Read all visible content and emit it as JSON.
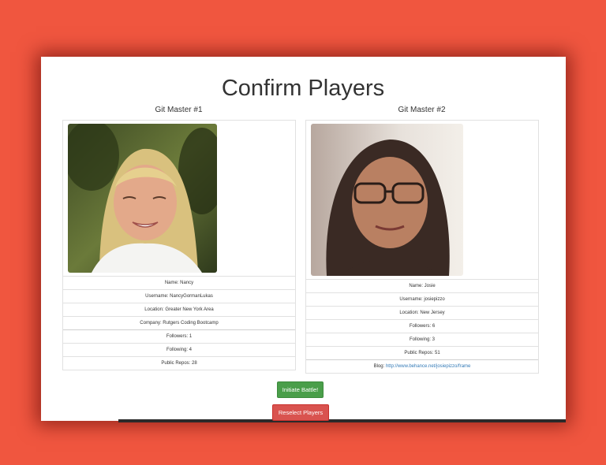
{
  "page": {
    "title": "Confirm Players"
  },
  "players": [
    {
      "heading": "Git Master #1",
      "name": "Name: Nancy",
      "username": "Username: NancyGormanLukas",
      "location": "Location: Greater New York Area",
      "company": "Company: Rutgers Coding Bootcamp",
      "followers": "Followers: 1",
      "following": "Following: 4",
      "public_repos": "Public Repos: 28"
    },
    {
      "heading": "Git Master #2",
      "name": "Name: Josie",
      "username": "Username: josiepizzo",
      "location": "Location: New Jersey",
      "followers": "Followers: 6",
      "following": "Following: 3",
      "public_repos": "Public Repos: 51",
      "blog_label": "Blog: ",
      "blog_url": "http://www.behance.net/josiepizzo/frame"
    }
  ],
  "actions": {
    "initiate_label": "Initiate Battle!",
    "reselect_label": "Reselect Players"
  }
}
